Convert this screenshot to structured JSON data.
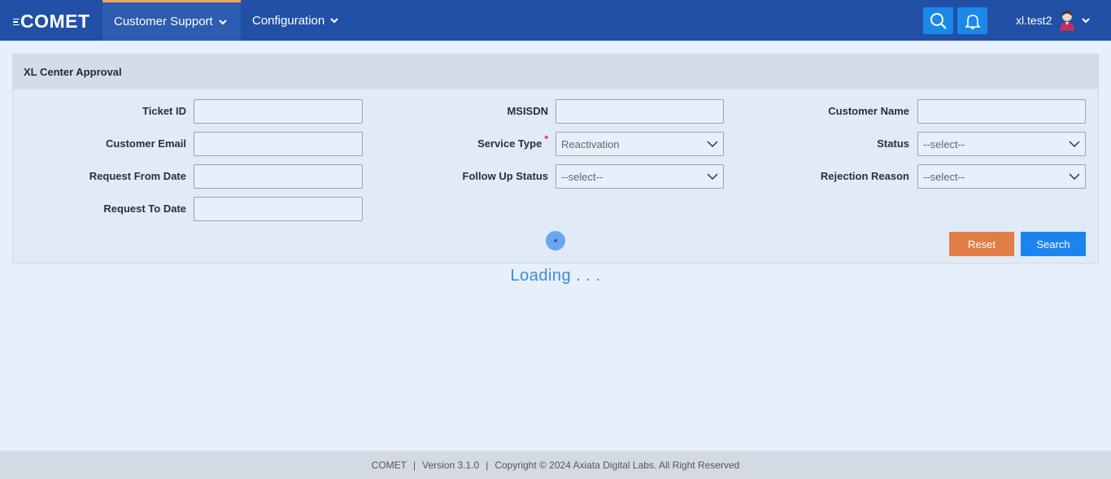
{
  "header": {
    "logo_text": "COMET",
    "nav": [
      {
        "label": "Customer Support",
        "active": true
      },
      {
        "label": "Configuration",
        "active": false
      }
    ],
    "search_icon": "search-icon",
    "bell_icon": "bell-icon",
    "username": "xl.test2",
    "accent_color": "#2150a6",
    "active_tab_color": "#f0a55a"
  },
  "panel": {
    "title": "XL Center Approval",
    "fields": {
      "ticket_id": {
        "label": "Ticket ID",
        "value": ""
      },
      "msisdn": {
        "label": "MSISDN",
        "value": ""
      },
      "customer_name": {
        "label": "Customer Name",
        "value": ""
      },
      "customer_email": {
        "label": "Customer Email",
        "value": ""
      },
      "service_type": {
        "label": "Service Type",
        "required_mark": "*",
        "value": "Reactivation"
      },
      "status": {
        "label": "Status",
        "value": "--select--"
      },
      "request_from_date": {
        "label": "Request From Date",
        "value": ""
      },
      "follow_up_status": {
        "label": "Follow Up Status",
        "value": "--select--"
      },
      "rejection_reason": {
        "label": "Rejection Reason",
        "value": "--select--"
      },
      "request_to_date": {
        "label": "Request To Date",
        "value": ""
      }
    },
    "buttons": {
      "reset": "Reset",
      "search": "Search"
    },
    "reset_color": "#e27d48",
    "search_color": "#1b84ee"
  },
  "loading_text": "Loading . . .",
  "footer": {
    "app": "COMET",
    "sep": "|",
    "version": "Version 3.1.0",
    "copyright": "Copyright © 2024 Axiata Digital Labs. All Right Reserved"
  }
}
